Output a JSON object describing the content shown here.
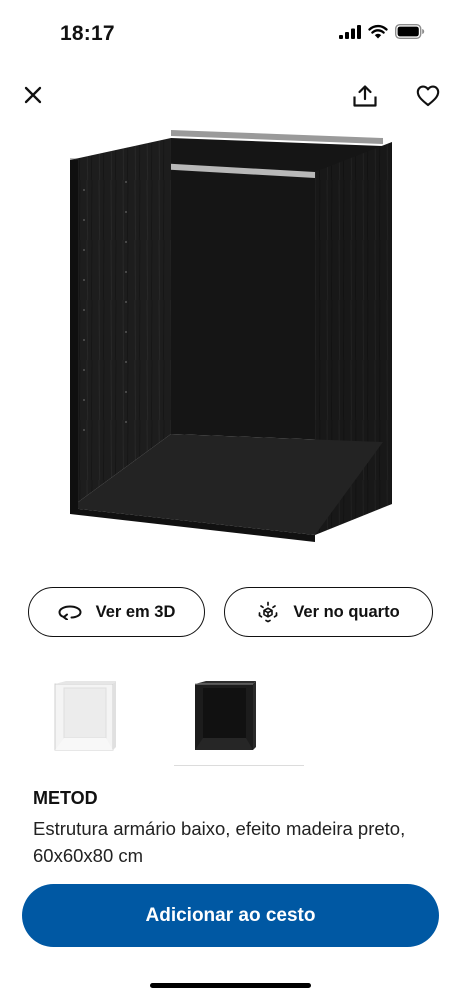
{
  "status_bar": {
    "time": "18:17",
    "signal_icon": "cellular-signal-icon",
    "wifi_icon": "wifi-icon",
    "battery_icon": "battery-icon"
  },
  "header": {
    "close_icon": "close-icon",
    "share_icon": "share-icon",
    "favorite_icon": "heart-icon"
  },
  "product": {
    "image_icon": "cabinet-frame-image",
    "name": "METOD",
    "description": "Estrutura armário baixo, efeito madeira preto, 60x60x80 cm"
  },
  "actions": {
    "view_3d_label": "Ver em 3D",
    "view_3d_icon": "rotate-3d-icon",
    "view_room_label": "Ver no quarto",
    "view_room_icon": "ar-cube-icon"
  },
  "variants": [
    {
      "name": "white-variant",
      "color": "#ffffff",
      "selected": false
    },
    {
      "name": "black-wood-variant",
      "color": "#1c1c1c",
      "selected": true
    }
  ],
  "cart": {
    "add_label": "Adicionar ao cesto",
    "button_color": "#0058a3"
  }
}
